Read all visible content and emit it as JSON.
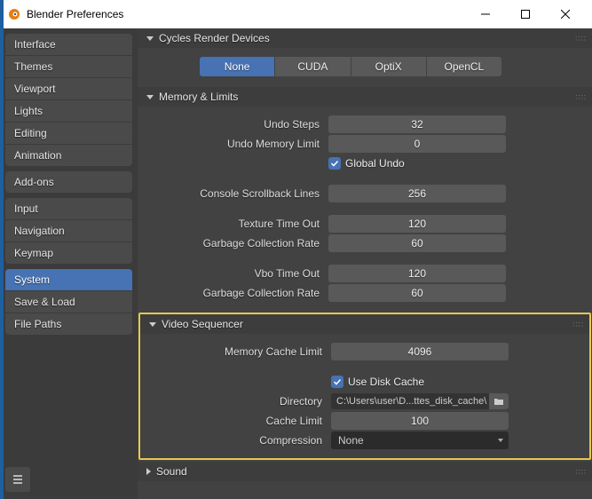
{
  "window": {
    "title": "Blender Preferences"
  },
  "sidebar": {
    "groups": [
      [
        "Interface",
        "Themes",
        "Viewport",
        "Lights",
        "Editing",
        "Animation"
      ],
      [
        "Add-ons"
      ],
      [
        "Input",
        "Navigation",
        "Keymap"
      ],
      [
        "System",
        "Save & Load",
        "File Paths"
      ]
    ],
    "active": "System"
  },
  "sections": {
    "cycles": {
      "title": "Cycles Render Devices",
      "options": [
        "None",
        "CUDA",
        "OptiX",
        "OpenCL"
      ],
      "active": "None"
    },
    "memory": {
      "title": "Memory & Limits",
      "undo_steps_label": "Undo Steps",
      "undo_steps": "32",
      "undo_mem_label": "Undo Memory Limit",
      "undo_mem": "0",
      "global_undo_label": "Global Undo",
      "console_label": "Console Scrollback Lines",
      "console": "256",
      "tex_timeout_label": "Texture Time Out",
      "tex_timeout": "120",
      "gc1_label": "Garbage Collection Rate",
      "gc1": "60",
      "vbo_label": "Vbo Time Out",
      "vbo": "120",
      "gc2_label": "Garbage Collection Rate",
      "gc2": "60"
    },
    "video": {
      "title": "Video Sequencer",
      "cache_label": "Memory Cache Limit",
      "cache": "4096",
      "disk_cache_label": "Use Disk Cache",
      "dir_label": "Directory",
      "dir": "C:\\Users\\user\\D...ttes_disk_cache\\",
      "limit_label": "Cache Limit",
      "limit": "100",
      "comp_label": "Compression",
      "comp": "None"
    },
    "sound": {
      "title": "Sound"
    }
  }
}
